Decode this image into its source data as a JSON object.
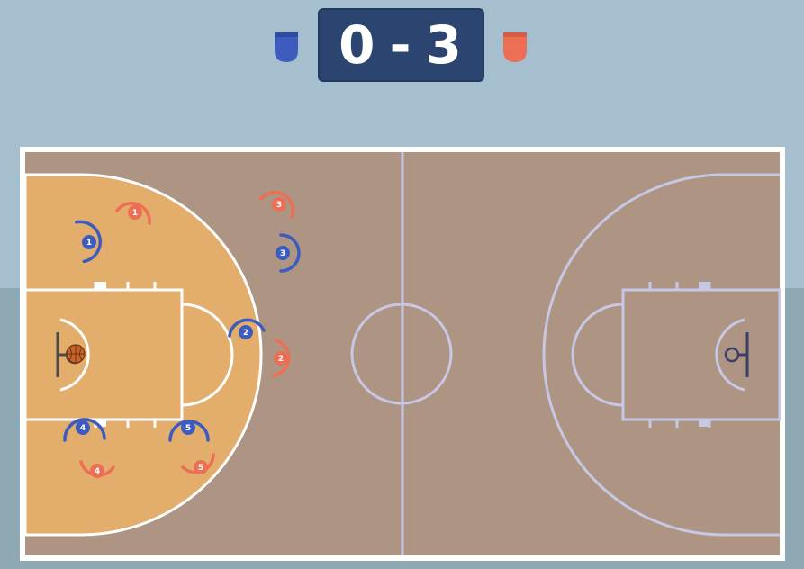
{
  "scoreboard": {
    "home_score": "0",
    "separator": "-",
    "away_score": "3",
    "home_color": "#3e5cbe",
    "away_color": "#ec6e55"
  },
  "court": {
    "wood_color": "#ae9482",
    "paint_color": "#e3ad6b",
    "line_color_active": "#ffffff",
    "line_color_inactive": "#c7c8e5"
  },
  "players": {
    "blue": [
      "1",
      "2",
      "3",
      "4",
      "5"
    ],
    "red": [
      "1",
      "2",
      "3",
      "4",
      "5"
    ]
  },
  "ball": {
    "icon": "basketball-icon",
    "holder": "blue-4"
  }
}
